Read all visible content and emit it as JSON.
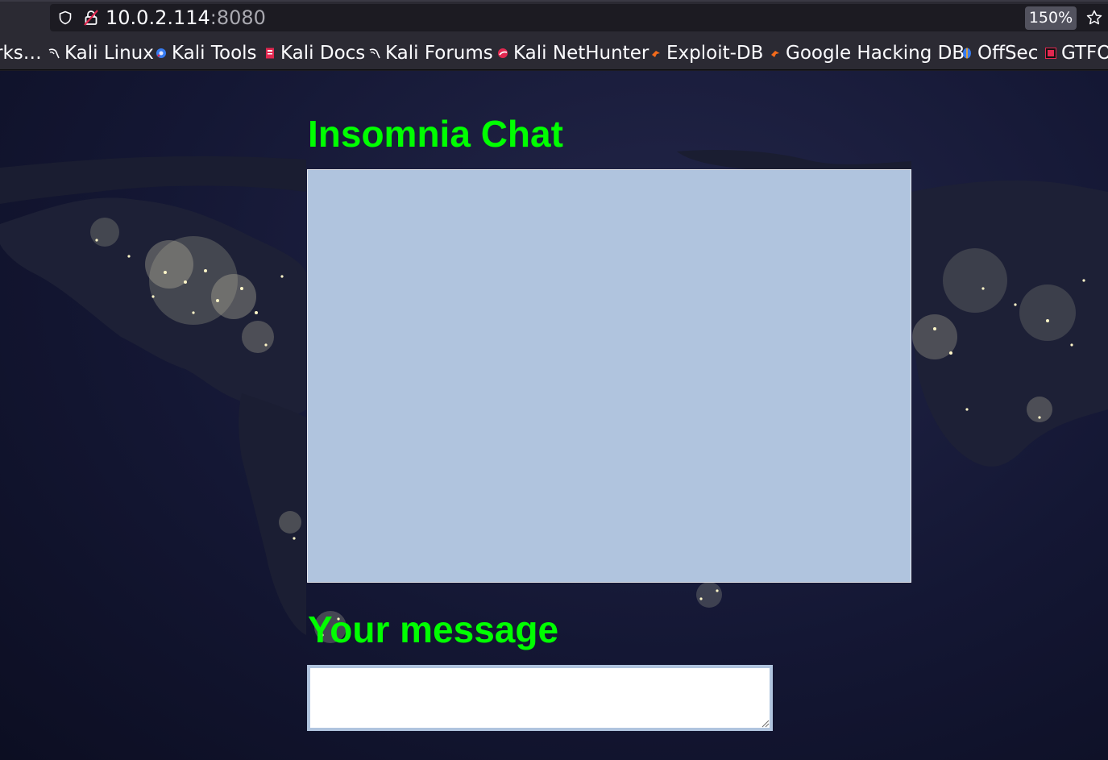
{
  "browser": {
    "url_host": "10.0.2.114",
    "url_port": ":8080",
    "zoom": "150%",
    "icons": {
      "tracking": "shield-icon",
      "connection": "insecure-lock-icon",
      "bookmark": "star-icon"
    }
  },
  "bookmarks": [
    {
      "label": "rks…",
      "icon": null
    },
    {
      "label": "Kali Linux",
      "icon": "kali-dragon-icon"
    },
    {
      "label": "Kali Tools",
      "icon": "kali-tools-icon"
    },
    {
      "label": "Kali Docs",
      "icon": "kali-docs-icon"
    },
    {
      "label": "Kali Forums",
      "icon": "kali-dragon-icon"
    },
    {
      "label": "Kali NetHunter",
      "icon": "nethunter-icon"
    },
    {
      "label": "Exploit-DB",
      "icon": "exploit-db-icon"
    },
    {
      "label": "Google Hacking DB",
      "icon": "ghdb-icon"
    },
    {
      "label": "OffSec",
      "icon": "offsec-icon"
    },
    {
      "label": "GTFO",
      "icon": "gtfobins-icon"
    }
  ],
  "page": {
    "title": "Insomnia Chat",
    "chat_log": "",
    "message_label": "Your message",
    "message_value": "",
    "colors": {
      "heading": "#00ff00",
      "chat_background": "#b0c4de",
      "input_border": "#b0c4de"
    }
  }
}
